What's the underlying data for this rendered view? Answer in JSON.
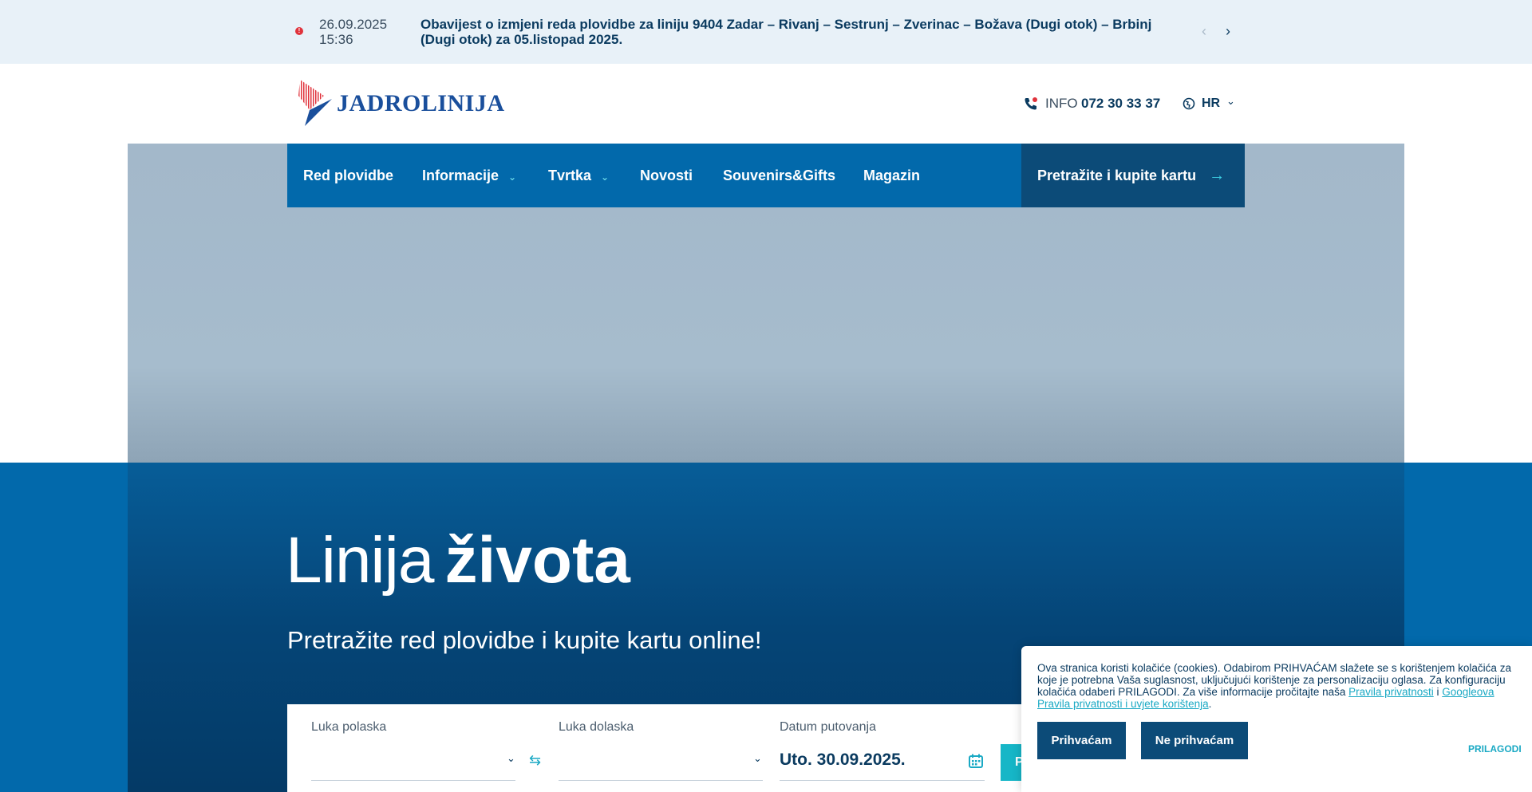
{
  "notice": {
    "date": "26.09.2025",
    "time": "15:36",
    "text": "Obavijest o izmjeni reda plovidbe za liniju 9404 Zadar – Rivanj – Sestrunj – Zverinac – Božava (Dugi otok) – Brbinj (Dugi otok) za 05.listopad 2025.",
    "prev_icon": "chevron-left-icon",
    "next_icon": "chevron-right-icon"
  },
  "header": {
    "logo_text": "JADROLINIJA",
    "phone_label": "INFO",
    "phone_number": "072 30 33 37",
    "language": "HR"
  },
  "nav": {
    "items": [
      {
        "label": "Red plovidbe",
        "dropdown": false
      },
      {
        "label": "Informacije",
        "dropdown": true
      },
      {
        "label": "Tvrtka",
        "dropdown": true
      },
      {
        "label": "Novosti",
        "dropdown": false
      },
      {
        "label": "Souvenirs&Gifts",
        "dropdown": false
      },
      {
        "label": "Magazin",
        "dropdown": false
      }
    ],
    "cta_label": "Pretražite i kupite kartu"
  },
  "hero": {
    "title_light": "Linija",
    "title_bold": "života",
    "subtitle": "Pretražite red plovidbe i kupite kartu online!"
  },
  "search": {
    "departure_label": "Luka polaska",
    "arrival_label": "Luka dolaska",
    "date_label": "Datum putovanja",
    "date_value": "Uto. 30.09.2025.",
    "button_label": "P"
  },
  "cookie": {
    "text_part1": "Ova stranica koristi kolačiće (cookies). Odabirom PRIHVAĆAM slažete se s korištenjem kolačića za koje je potrebna Vaša suglasnost, uključujući korištenje za personalizaciju oglasa. Za konfiguraciju kolačića odaberi PRILAGODI. Za više informacije pročitajte naša ",
    "link1": "Pravila privatnosti",
    "text_part2": " i ",
    "link2": "Googleova Pravila privatnosti i uvjete korištenja",
    "text_part3": ".",
    "accept_label": "Prihvaćam",
    "reject_label": "Ne prihvaćam",
    "customize_label": "PRILAGODI"
  },
  "colors": {
    "primary": "#0269ab",
    "dark": "#0c4b78",
    "accent": "#16b6c7",
    "alert": "#e0333c"
  }
}
